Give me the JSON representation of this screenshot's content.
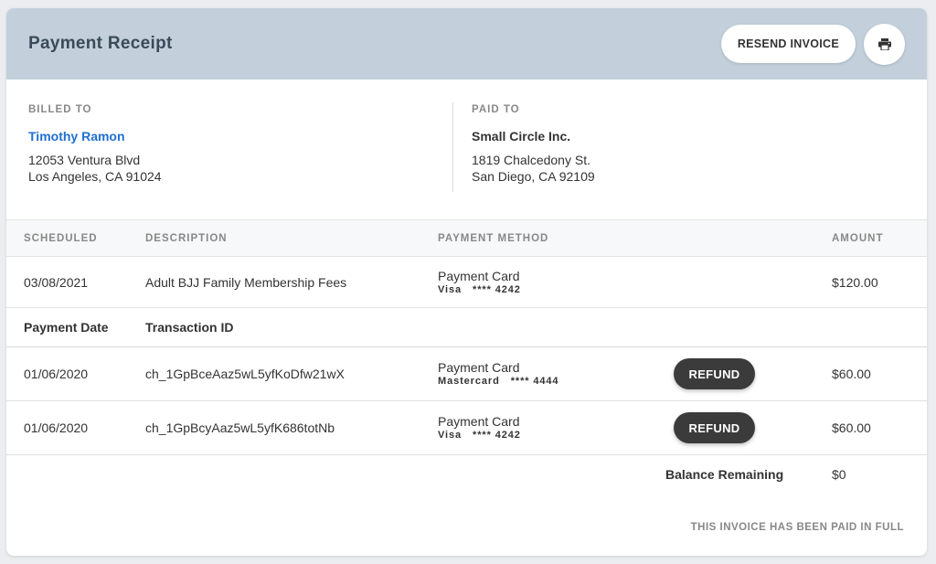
{
  "header": {
    "title": "Payment Receipt",
    "resend_label": "RESEND INVOICE",
    "print_icon": "printer-icon"
  },
  "billed_to": {
    "label": "BILLED TO",
    "name": "Timothy Ramon",
    "address_line1": "12053 Ventura Blvd",
    "address_line2": "Los Angeles, CA 91024"
  },
  "paid_to": {
    "label": "PAID TO",
    "name": "Small Circle Inc.",
    "address_line1": "1819 Chalcedony St.",
    "address_line2": "San Diego, CA 92109"
  },
  "table": {
    "headers": [
      "SCHEDULED",
      "DESCRIPTION",
      "PAYMENT METHOD",
      "",
      "AMOUNT"
    ],
    "scheduled": {
      "date": "03/08/2021",
      "description": "Adult BJJ Family Membership Fees",
      "method_title": "Payment Card",
      "card_brand": "Visa",
      "card_mask": "**** 4242",
      "amount": "$120.00"
    },
    "sub_headers": [
      "Payment Date",
      "Transaction ID"
    ],
    "payments": [
      {
        "date": "01/06/2020",
        "transaction_id": "ch_1GpBceAaz5wL5yfKoDfw21wX",
        "method_title": "Payment Card",
        "card_brand": "Mastercard",
        "card_mask": "**** 4444",
        "refund_label": "REFUND",
        "amount": "$60.00"
      },
      {
        "date": "01/06/2020",
        "transaction_id": "ch_1GpBcyAaz5wL5yfK686totNb",
        "method_title": "Payment Card",
        "card_brand": "Visa",
        "card_mask": "**** 4242",
        "refund_label": "REFUND",
        "amount": "$60.00"
      }
    ],
    "balance_label": "Balance Remaining",
    "balance_value": "$0"
  },
  "footer_note": "THIS INVOICE HAS BEEN PAID IN FULL",
  "colors": {
    "header_bg": "#c3d0db",
    "link": "#1f6fd1",
    "refund_bg": "#3b3b3b"
  }
}
